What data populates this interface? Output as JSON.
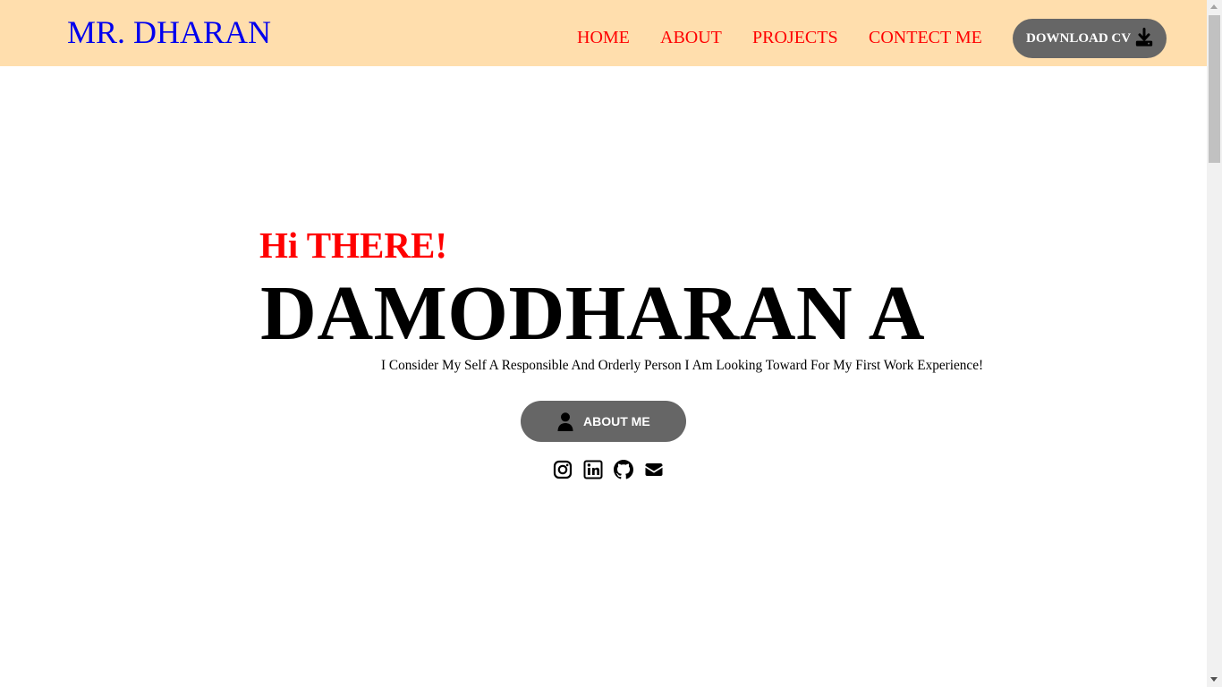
{
  "navbar": {
    "brand": "MR. DHARAN",
    "links": [
      {
        "label": "HOME"
      },
      {
        "label": "ABOUT"
      },
      {
        "label": "PROJECTS"
      },
      {
        "label": "CONTECT ME"
      }
    ],
    "cv_button": {
      "label": "DOWNLOAD CV",
      "icon": "download-icon"
    }
  },
  "hero": {
    "greeting": "Hi THERE!",
    "name": "DAMODHARAN A",
    "tagline": "I Consider My Self A Responsible And Orderly Person I Am Looking Toward For My First Work Experience!",
    "about_button": {
      "label": "ABOUT ME",
      "icon": "user-icon"
    },
    "social_icons": [
      "instagram-icon",
      "linkedin-icon",
      "github-icon",
      "mail-icon"
    ]
  },
  "colors": {
    "navbar_bg": "#ffdead",
    "brand": "#0000ee",
    "nav_link": "#ff0000",
    "greeting": "#ff0000",
    "button_bg": "#666666",
    "button_text": "#ffffff"
  }
}
